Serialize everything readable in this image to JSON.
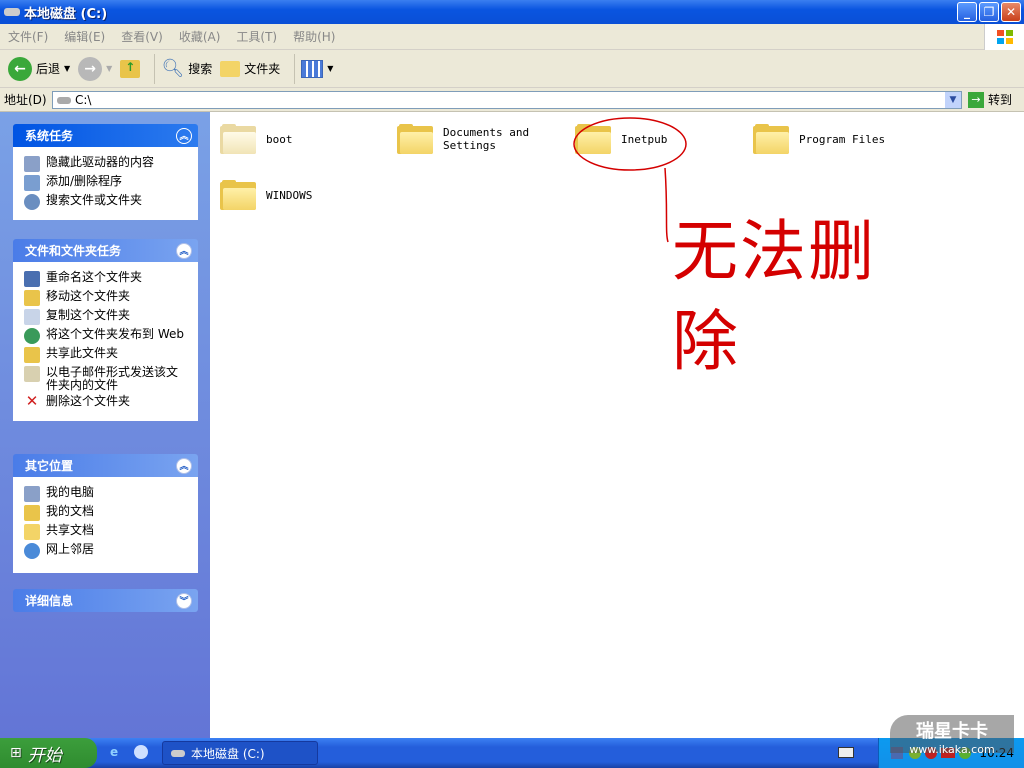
{
  "window": {
    "title": "本地磁盘 (C:)"
  },
  "menu": [
    "文件(F)",
    "编辑(E)",
    "查看(V)",
    "收藏(A)",
    "工具(T)",
    "帮助(H)"
  ],
  "toolbar": {
    "back": "后退",
    "search": "搜索",
    "folders": "文件夹"
  },
  "address": {
    "label": "地址(D)",
    "value": "C:\\",
    "go": "转到"
  },
  "sidebar": {
    "system_tasks": {
      "title": "系统任务",
      "items": [
        "隐藏此驱动器的内容",
        "添加/删除程序",
        "搜索文件或文件夹"
      ]
    },
    "file_tasks": {
      "title": "文件和文件夹任务",
      "items": [
        "重命名这个文件夹",
        "移动这个文件夹",
        "复制这个文件夹",
        "将这个文件夹发布到 Web",
        "共享此文件夹",
        "以电子邮件形式发送该文件夹内的文件",
        "删除这个文件夹"
      ]
    },
    "other_places": {
      "title": "其它位置",
      "items": [
        "我的电脑",
        "我的文档",
        "共享文档",
        "网上邻居"
      ]
    },
    "details": {
      "title": "详细信息"
    }
  },
  "folders": [
    "boot",
    "Documents and Settings",
    "Inetpub",
    "Program Files",
    "WINDOWS"
  ],
  "annotation": {
    "text": "无法删除",
    "color": "#d40000"
  },
  "taskbar": {
    "start": "开始",
    "task": "本地磁盘 (C:)",
    "clock": "10:24"
  },
  "watermark": {
    "text": "瑞星卡卡",
    "url": "www.ikaka.com"
  }
}
